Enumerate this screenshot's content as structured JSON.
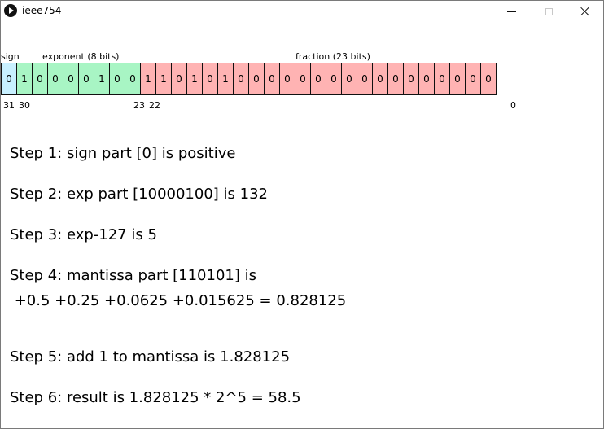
{
  "window": {
    "title": "ieee754"
  },
  "labels": {
    "sign": "sign",
    "exponent": "exponent (8 bits)",
    "fraction": "fraction (23 bits)"
  },
  "bits": {
    "sign": [
      "0"
    ],
    "exponent": [
      "1",
      "0",
      "0",
      "0",
      "0",
      "1",
      "0",
      "0"
    ],
    "fraction": [
      "1",
      "1",
      "0",
      "1",
      "0",
      "1",
      "0",
      "0",
      "0",
      "0",
      "0",
      "0",
      "0",
      "0",
      "0",
      "0",
      "0",
      "0",
      "0",
      "0",
      "0",
      "0",
      "0"
    ]
  },
  "bit_indices": {
    "i31": "31",
    "i30": "30",
    "i23": "23",
    "i22": "22",
    "i0": "0"
  },
  "steps": {
    "step1": "Step 1: sign part [0] is positive",
    "step2": "Step 2: exp part [10000100] is 132",
    "step3": "Step 3: exp-127 is 5",
    "step4": "Step 4: mantissa part [110101] is",
    "step4_detail": " +0.5 +0.25 +0.0625 +0.015625 = 0.828125",
    "step5": "Step 5: add 1 to mantissa is 1.828125",
    "step6": "Step 6: result is 1.828125 * 2^5 = 58.5"
  },
  "colors": {
    "sign_bit": "#c8f0ff",
    "exponent_bits": "#a8f5c4",
    "fraction_bits": "#ffb3b3"
  },
  "icons": {
    "app": "play-circle-icon",
    "minimize": "minimize-icon",
    "maximize": "maximize-icon",
    "close": "close-icon"
  }
}
